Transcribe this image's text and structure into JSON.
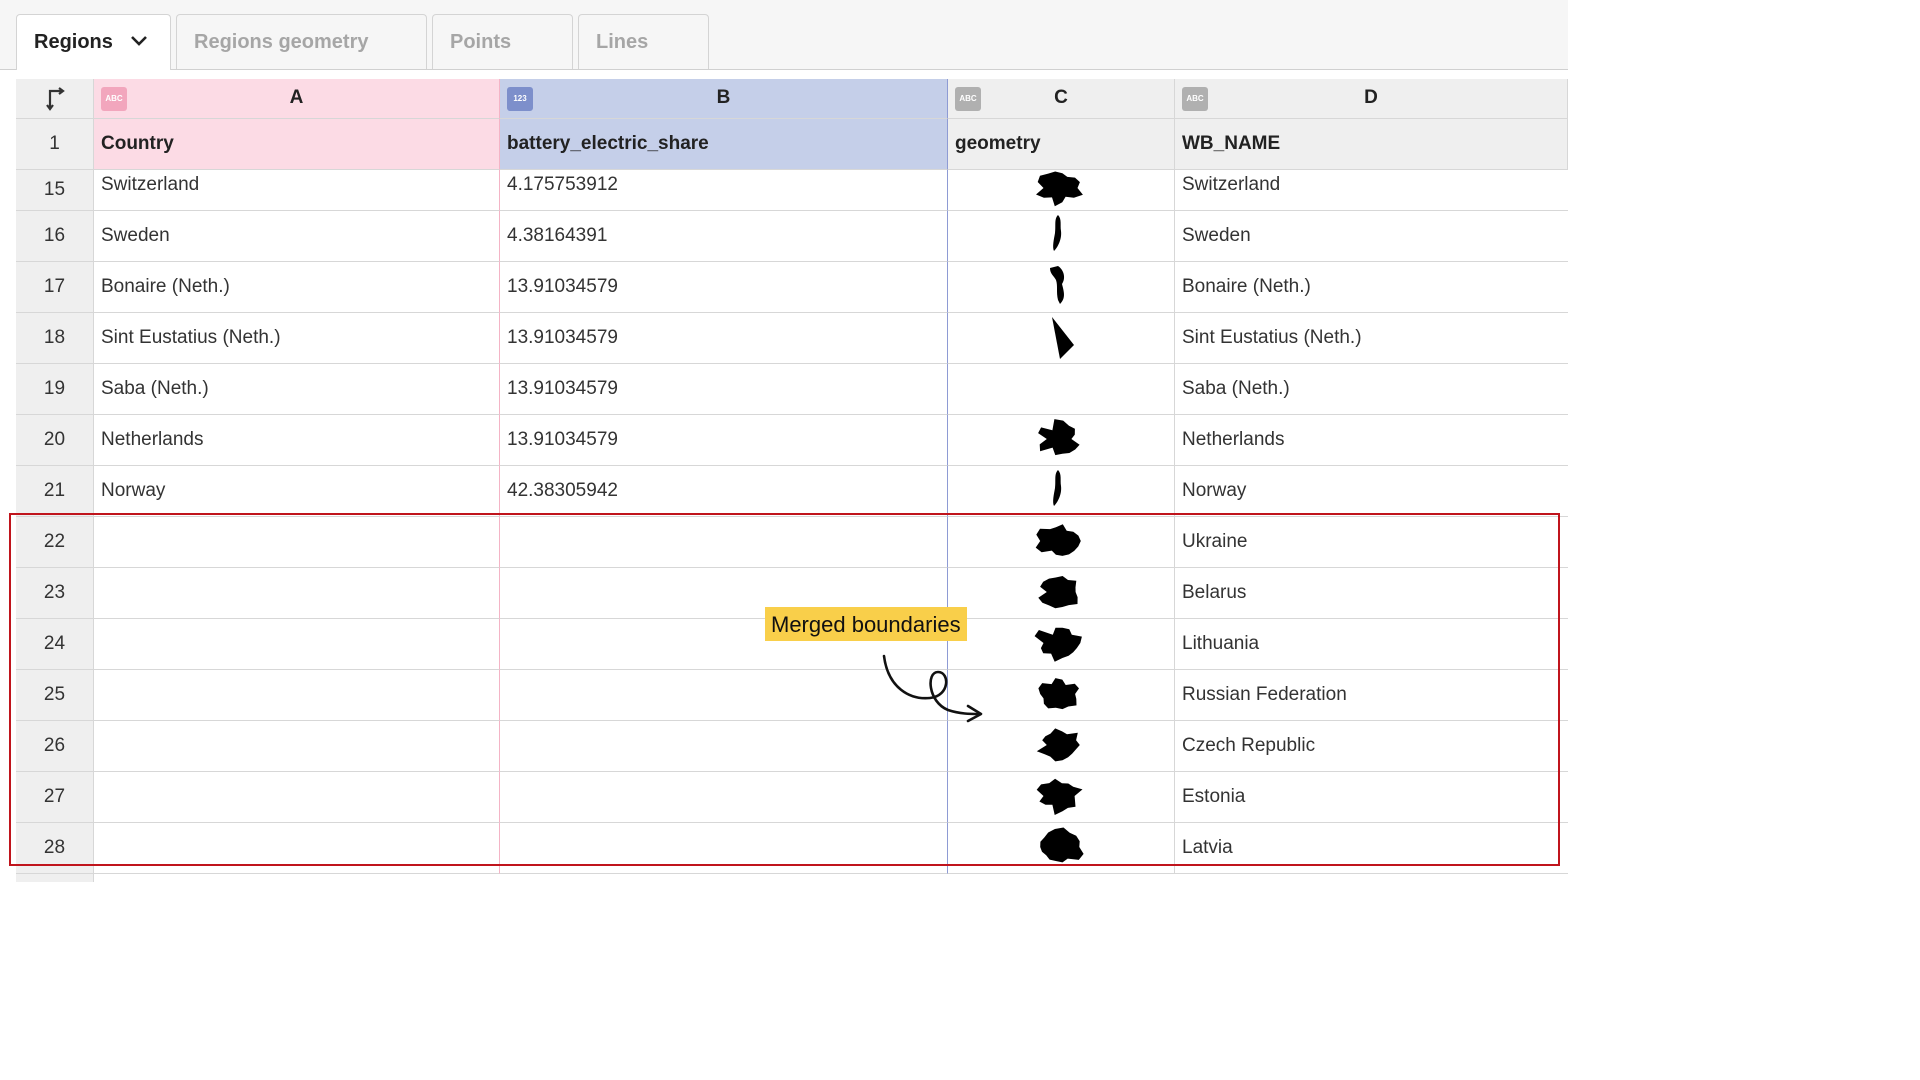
{
  "tabs": [
    {
      "label": "Regions",
      "active": true
    },
    {
      "label": "Regions geometry",
      "active": false
    },
    {
      "label": "Points",
      "active": false
    },
    {
      "label": "Lines",
      "active": false
    }
  ],
  "columns": [
    {
      "letter": "A",
      "type_badge": "ABC",
      "header": "Country",
      "badge_color": "#f2a6bd",
      "header_bg": "#fcdbe5",
      "border_color": "#f4b4c6"
    },
    {
      "letter": "B",
      "type_badge": "123",
      "header": "battery_electric_share",
      "badge_color": "#7d8fcb",
      "header_bg": "#c5cfe9",
      "border_color": "#8e9bd4"
    },
    {
      "letter": "C",
      "type_badge": "ABC",
      "header": "geometry",
      "badge_color": "#b0b0b0",
      "header_bg": "#efefef",
      "border_color": "#d7d7d7"
    },
    {
      "letter": "D",
      "type_badge": "ABC",
      "header": "WB_NAME",
      "badge_color": "#b0b0b0",
      "header_bg": "#efefef",
      "border_color": "#d7d7d7"
    }
  ],
  "header_row_number": "1",
  "rows": [
    {
      "num": "15",
      "country": "Switzerland",
      "share": "4.175753912",
      "geometry_icon": "switzerland-shape-icon",
      "wb_name": "Switzerland"
    },
    {
      "num": "16",
      "country": "Sweden",
      "share": "4.38164391",
      "geometry_icon": "sweden-shape-icon",
      "wb_name": "Sweden"
    },
    {
      "num": "17",
      "country": "Bonaire (Neth.)",
      "share": "13.91034579",
      "geometry_icon": "bonaire-shape-icon",
      "wb_name": "Bonaire (Neth.)"
    },
    {
      "num": "18",
      "country": "Sint Eustatius (Neth.)",
      "share": "13.91034579",
      "geometry_icon": "sint-eustatius-shape-icon",
      "wb_name": "Sint Eustatius (Neth.)"
    },
    {
      "num": "19",
      "country": "Saba (Neth.)",
      "share": "13.91034579",
      "geometry_icon": "",
      "wb_name": "Saba (Neth.)"
    },
    {
      "num": "20",
      "country": "Netherlands",
      "share": "13.91034579",
      "geometry_icon": "netherlands-shape-icon",
      "wb_name": "Netherlands"
    },
    {
      "num": "21",
      "country": "Norway",
      "share": "42.38305942",
      "geometry_icon": "norway-shape-icon",
      "wb_name": "Norway"
    },
    {
      "num": "22",
      "country": "",
      "share": "",
      "geometry_icon": "ukraine-shape-icon",
      "wb_name": "Ukraine"
    },
    {
      "num": "23",
      "country": "",
      "share": "",
      "geometry_icon": "belarus-shape-icon",
      "wb_name": "Belarus"
    },
    {
      "num": "24",
      "country": "",
      "share": "",
      "geometry_icon": "lithuania-shape-icon",
      "wb_name": "Lithuania"
    },
    {
      "num": "25",
      "country": "",
      "share": "",
      "geometry_icon": "russia-shape-icon",
      "wb_name": "Russian Federation"
    },
    {
      "num": "26",
      "country": "",
      "share": "",
      "geometry_icon": "czech-shape-icon",
      "wb_name": "Czech Republic"
    },
    {
      "num": "27",
      "country": "",
      "share": "",
      "geometry_icon": "estonia-shape-icon",
      "wb_name": "Estonia"
    },
    {
      "num": "28",
      "country": "",
      "share": "",
      "geometry_icon": "latvia-shape-icon",
      "wb_name": "Latvia"
    }
  ],
  "annotation": {
    "label": "Merged boundaries",
    "highlight_color": "#c0141c",
    "label_bg": "#f9cf4a"
  }
}
